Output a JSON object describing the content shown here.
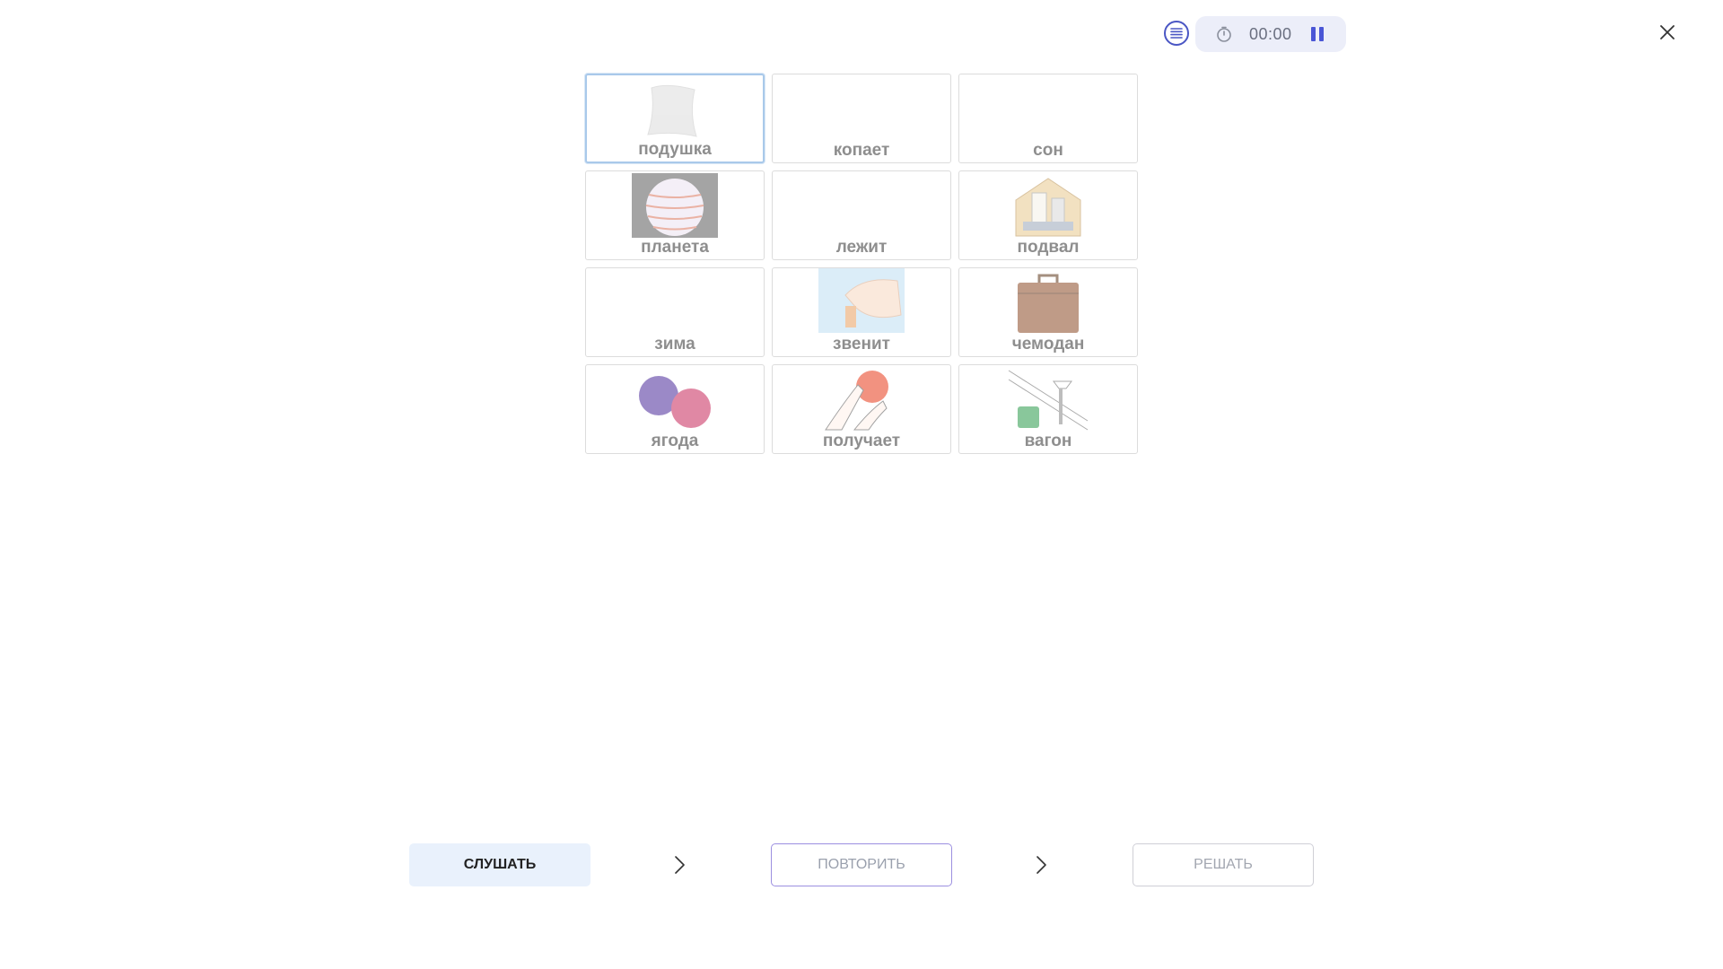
{
  "header": {
    "list_icon": "list-icon",
    "timer": {
      "clock_icon": "stopwatch-icon",
      "time": "00:00",
      "pause_icon": "pause-icon"
    },
    "close_icon": "close-icon"
  },
  "cards": [
    {
      "label": "подушка",
      "image": "pillow",
      "selected": true
    },
    {
      "label": "копает",
      "image": "none",
      "selected": false
    },
    {
      "label": "сон",
      "image": "none",
      "selected": false
    },
    {
      "label": "планета",
      "image": "planet",
      "selected": false
    },
    {
      "label": "лежит",
      "image": "none",
      "selected": false
    },
    {
      "label": "подвал",
      "image": "basement",
      "selected": false
    },
    {
      "label": "зима",
      "image": "none",
      "selected": false
    },
    {
      "label": "звенит",
      "image": "doorbell",
      "selected": false
    },
    {
      "label": "чемодан",
      "image": "suitcase",
      "selected": false
    },
    {
      "label": "ягода",
      "image": "berry",
      "selected": false
    },
    {
      "label": "получает",
      "image": "receiving-ball",
      "selected": false
    },
    {
      "label": "вагон",
      "image": "cable-car",
      "selected": false
    }
  ],
  "footer": {
    "listen_label": "СЛУШАТЬ",
    "repeat_label": "ПОВТОРИТЬ",
    "solve_label": "РЕШАТЬ",
    "step_icon": "chevron-right-icon"
  },
  "colors": {
    "accent": "#4a56d6",
    "selected_border": "#a9c9ea",
    "listen_bg": "#e9f1fc",
    "repeat_border": "#9c8fe0"
  }
}
